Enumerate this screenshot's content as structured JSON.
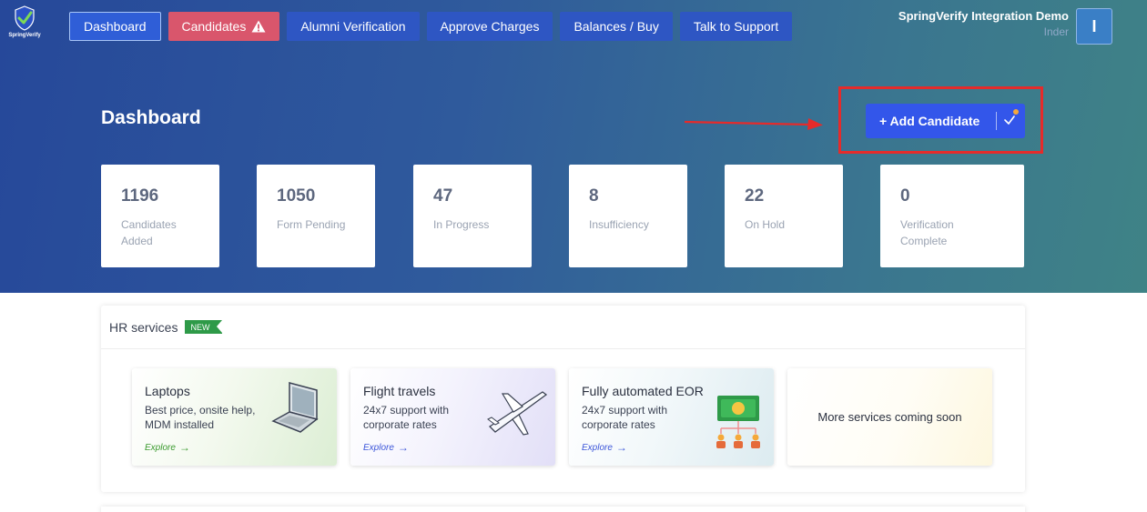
{
  "brand": {
    "logo_text": "SpringVerify"
  },
  "nav": {
    "items": [
      {
        "label": "Dashboard"
      },
      {
        "label": "Candidates"
      },
      {
        "label": "Alumni Verification"
      },
      {
        "label": "Approve Charges"
      },
      {
        "label": "Balances / Buy"
      },
      {
        "label": "Talk to Support"
      }
    ]
  },
  "user": {
    "org": "SpringVerify Integration Demo",
    "name": "Inder",
    "avatar_initial": "I"
  },
  "header": {
    "title": "Dashboard",
    "add_button_label": "+ Add Candidate"
  },
  "stats": [
    {
      "value": "1196",
      "label": "Candidates Added"
    },
    {
      "value": "1050",
      "label": "Form Pending"
    },
    {
      "value": "47",
      "label": "In Progress"
    },
    {
      "value": "8",
      "label": "Insufficiency"
    },
    {
      "value": "22",
      "label": "On Hold"
    },
    {
      "value": "0",
      "label": "Verification Complete"
    }
  ],
  "hr_services": {
    "title": "HR services",
    "badge": "NEW",
    "cards": [
      {
        "title": "Laptops",
        "desc": "Best price, onsite help, MDM installed",
        "cta": "Explore",
        "icon": "laptop-icon",
        "accent": "#3a9a2e"
      },
      {
        "title": "Flight travels",
        "desc": "24x7 support with corporate rates",
        "cta": "Explore",
        "icon": "airplane-icon",
        "accent": "#3b55d9"
      },
      {
        "title": "Fully automated EOR",
        "desc": "24x7 support with corporate rates",
        "cta": "Explore",
        "icon": "money-network-icon",
        "accent": "#3b55d9"
      },
      {
        "title": "More services coming soon"
      }
    ]
  },
  "colors": {
    "accent": "#3356ea",
    "alert": "#d9566c",
    "highlight": "#e52b2b",
    "new_badge": "#2e9a48"
  }
}
